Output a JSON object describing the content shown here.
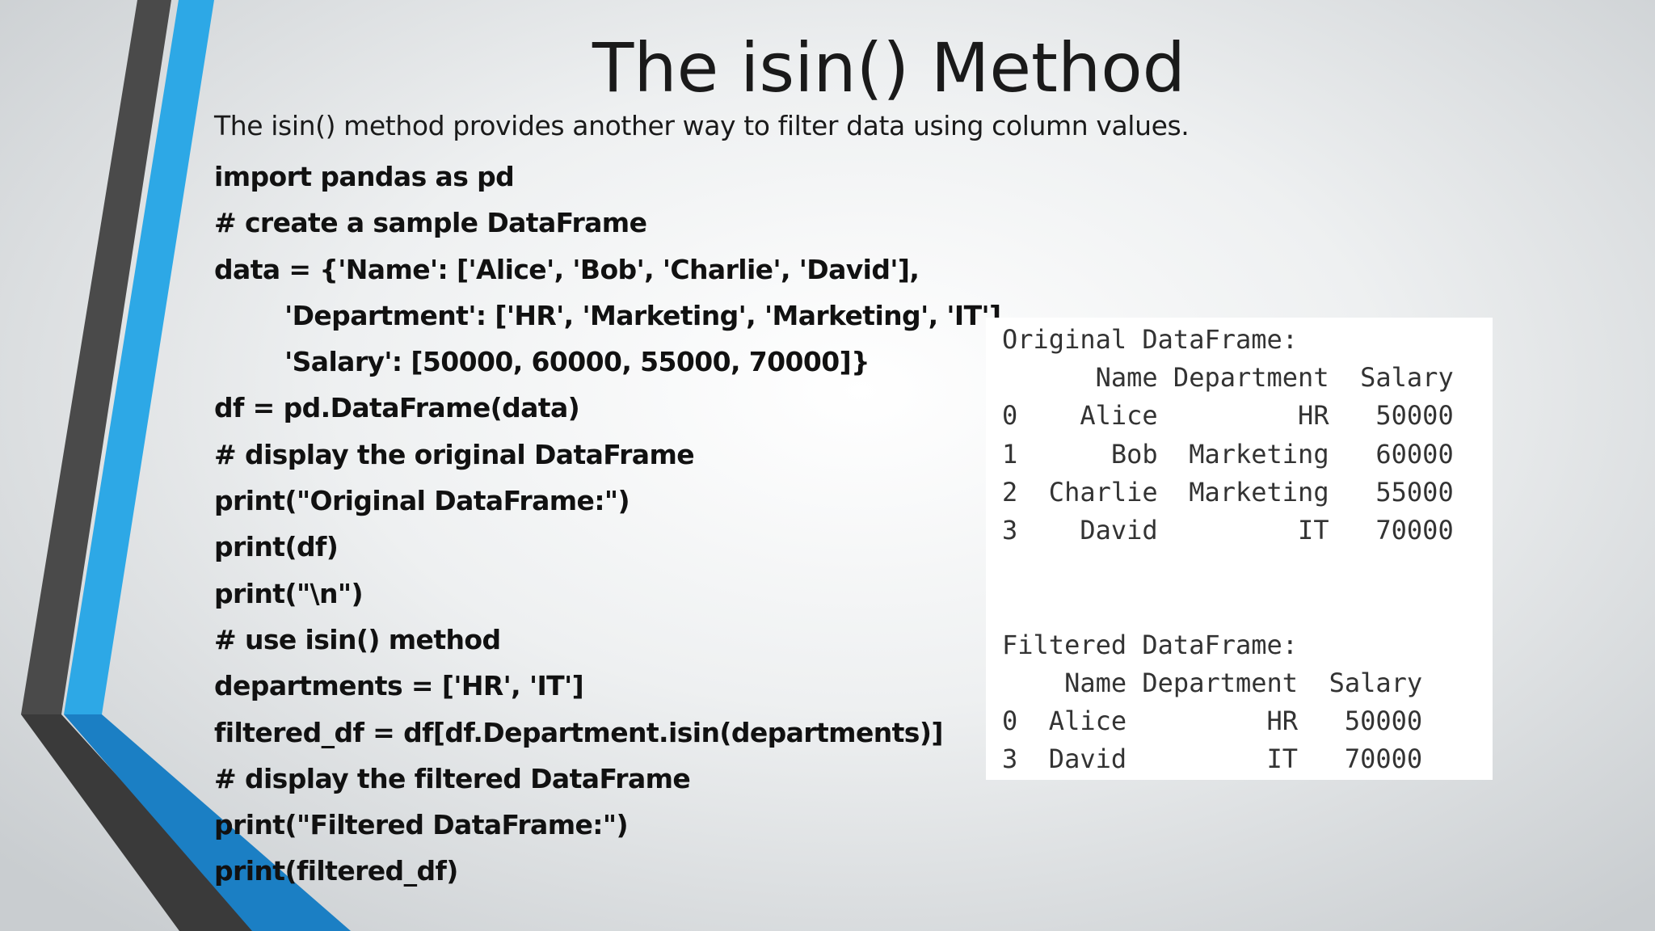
{
  "slide": {
    "title": "The isin() Method",
    "intro": "The isin() method provides another way to filter data using column values.",
    "code_lines": [
      "import pandas as pd",
      "# create a sample DataFrame",
      "data = {'Name': ['Alice', 'Bob', 'Charlie', 'David'],",
      "        'Department': ['HR', 'Marketing', 'Marketing', 'IT'],",
      "        'Salary': [50000, 60000, 55000, 70000]}",
      "df = pd.DataFrame(data)",
      "# display the original DataFrame",
      "print(\"Original DataFrame:\")",
      "print(df)",
      "print(\"\\n\")",
      "# use isin() method",
      "departments = ['HR', 'IT']",
      "filtered_df = df[df.Department.isin(departments)]",
      "# display the filtered DataFrame",
      "print(\"Filtered DataFrame:\")",
      "print(filtered_df)"
    ],
    "output_text": "Original DataFrame:\n      Name Department  Salary\n0    Alice         HR   50000\n1      Bob  Marketing   60000\n2  Charlie  Marketing   55000\n3    David         IT   70000\n\n\nFiltered DataFrame:\n    Name Department  Salary\n0  Alice         HR   50000\n3  David         IT   70000",
    "colors": {
      "accent_blue": "#2da8e6",
      "accent_dark": "#3d3d3d",
      "accent_deep_blue": "#1b7fc4"
    }
  }
}
